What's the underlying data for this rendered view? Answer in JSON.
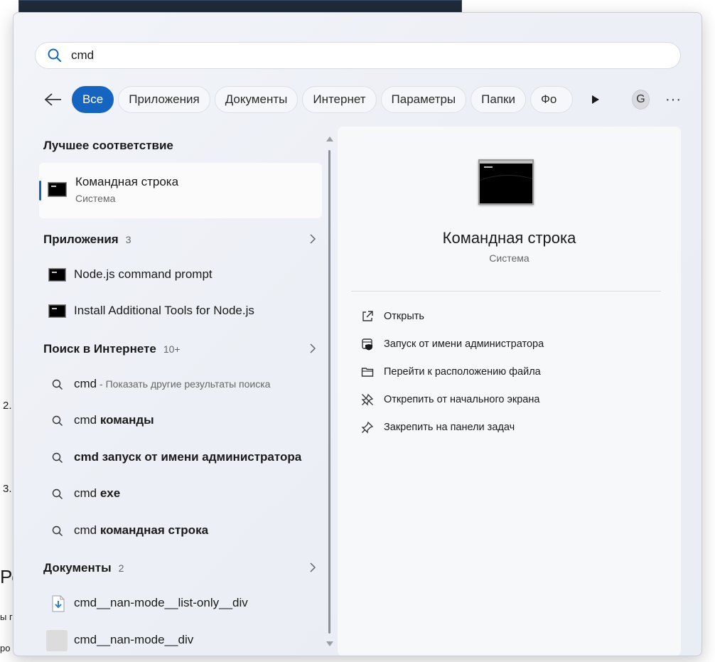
{
  "background": {
    "frag_2": "2.",
    "frag_3": "3.",
    "frag_re": "Ре",
    "frag_yi": "ы г",
    "frag_ro": "ро"
  },
  "search": {
    "query": "cmd"
  },
  "filters": {
    "chips": [
      "Все",
      "Приложения",
      "Документы",
      "Интернет",
      "Параметры",
      "Папки",
      "Фо"
    ],
    "avatar_letter": "G",
    "more_label": "···"
  },
  "results": {
    "best_match_header": "Лучшее соответствие",
    "best_match": {
      "title": "Командная строка",
      "subtitle": "Система"
    },
    "apps_header": "Приложения",
    "apps_count": "3",
    "apps": [
      {
        "title": "Node.js command prompt"
      },
      {
        "title": "Install Additional Tools for Node.js"
      }
    ],
    "web_header": "Поиск в Интернете",
    "web_count": "10+",
    "web": [
      {
        "prefix": "cmd",
        "bold": "",
        "suffix": " - Показать другие результаты поиска"
      },
      {
        "prefix": "cmd ",
        "bold": "команды",
        "suffix": ""
      },
      {
        "prefix": "",
        "bold": "cmd запуск от имени администратора",
        "suffix": ""
      },
      {
        "prefix": "cmd ",
        "bold": "exe",
        "suffix": ""
      },
      {
        "prefix": "cmd ",
        "bold": "командная строка",
        "suffix": ""
      }
    ],
    "docs_header": "Документы",
    "docs_count": "2",
    "docs": [
      {
        "title": "cmd__nan-mode__list-only__div",
        "icon": "downloaded-file-icon"
      },
      {
        "title": "cmd__nan-mode__div",
        "icon": "blank-thumbnail-icon"
      }
    ]
  },
  "detail": {
    "title": "Командная строка",
    "subtitle": "Система",
    "actions": [
      {
        "label": "Открыть",
        "icon": "open-external-icon"
      },
      {
        "label": "Запуск от имени администратора",
        "icon": "admin-shield-icon"
      },
      {
        "label": "Перейти к расположению файла",
        "icon": "folder-icon"
      },
      {
        "label": "Открепить от начального экрана",
        "icon": "unpin-icon"
      },
      {
        "label": "Закрепить на панели задач",
        "icon": "pin-icon"
      }
    ]
  },
  "colors": {
    "accent": "#1565c0",
    "panel_bg": "#eceff5"
  }
}
